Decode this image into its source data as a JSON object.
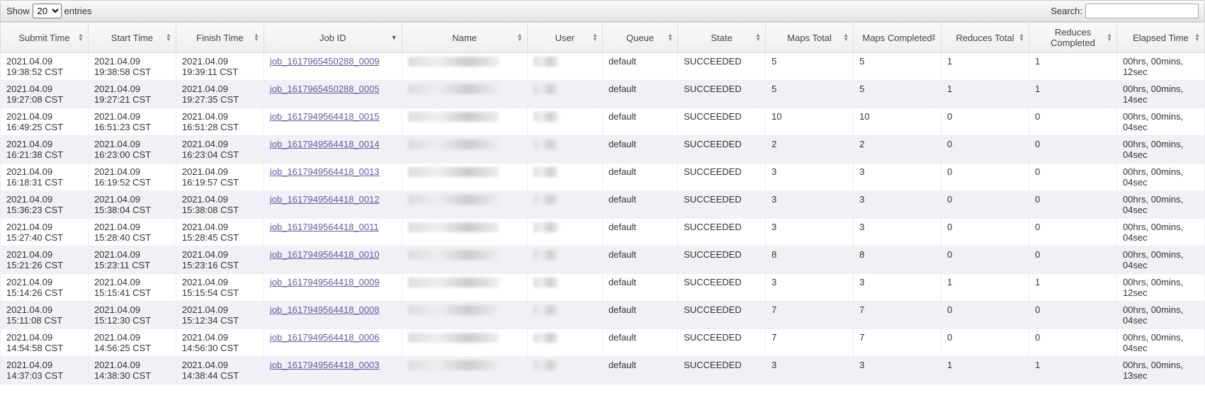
{
  "toolbar": {
    "show_label": "Show",
    "entries_label": "entries",
    "entries_value": "20",
    "search_label": "Search:"
  },
  "columns": [
    {
      "label": "Submit Time",
      "sort": "both"
    },
    {
      "label": "Start Time",
      "sort": "both"
    },
    {
      "label": "Finish Time",
      "sort": "both"
    },
    {
      "label": "Job ID",
      "sort": "desc"
    },
    {
      "label": "Name",
      "sort": "both"
    },
    {
      "label": "User",
      "sort": "both"
    },
    {
      "label": "Queue",
      "sort": "both"
    },
    {
      "label": "State",
      "sort": "both"
    },
    {
      "label": "Maps Total",
      "sort": "both"
    },
    {
      "label": "Maps Completed",
      "sort": "both"
    },
    {
      "label": "Reduces Total",
      "sort": "both"
    },
    {
      "label": "Reduces Completed",
      "sort": "both"
    },
    {
      "label": "Elapsed Time",
      "sort": "both"
    }
  ],
  "rows": [
    {
      "submit": "2021.04.09 19:38:52 CST",
      "start": "2021.04.09 19:38:58 CST",
      "finish": "2021.04.09 19:39:11 CST",
      "jobid": "job_1617965450288_0009",
      "queue": "default",
      "state": "SUCCEEDED",
      "maps": "5",
      "mapsc": "5",
      "red": "1",
      "redc": "1",
      "elapsed": "00hrs, 00mins, 12sec"
    },
    {
      "submit": "2021.04.09 19:27:08 CST",
      "start": "2021.04.09 19:27:21 CST",
      "finish": "2021.04.09 19:27:35 CST",
      "jobid": "job_1617965450288_0005",
      "queue": "default",
      "state": "SUCCEEDED",
      "maps": "5",
      "mapsc": "5",
      "red": "1",
      "redc": "1",
      "elapsed": "00hrs, 00mins, 14sec"
    },
    {
      "submit": "2021.04.09 16:49:25 CST",
      "start": "2021.04.09 16:51:23 CST",
      "finish": "2021.04.09 16:51:28 CST",
      "jobid": "job_1617949564418_0015",
      "queue": "default",
      "state": "SUCCEEDED",
      "maps": "10",
      "mapsc": "10",
      "red": "0",
      "redc": "0",
      "elapsed": "00hrs, 00mins, 04sec"
    },
    {
      "submit": "2021.04.09 16:21:38 CST",
      "start": "2021.04.09 16:23:00 CST",
      "finish": "2021.04.09 16:23:04 CST",
      "jobid": "job_1617949564418_0014",
      "queue": "default",
      "state": "SUCCEEDED",
      "maps": "2",
      "mapsc": "2",
      "red": "0",
      "redc": "0",
      "elapsed": "00hrs, 00mins, 04sec"
    },
    {
      "submit": "2021.04.09 16:18:31 CST",
      "start": "2021.04.09 16:19:52 CST",
      "finish": "2021.04.09 16:19:57 CST",
      "jobid": "job_1617949564418_0013",
      "queue": "default",
      "state": "SUCCEEDED",
      "maps": "3",
      "mapsc": "3",
      "red": "0",
      "redc": "0",
      "elapsed": "00hrs, 00mins, 04sec"
    },
    {
      "submit": "2021.04.09 15:36:23 CST",
      "start": "2021.04.09 15:38:04 CST",
      "finish": "2021.04.09 15:38:08 CST",
      "jobid": "job_1617949564418_0012",
      "queue": "default",
      "state": "SUCCEEDED",
      "maps": "3",
      "mapsc": "3",
      "red": "0",
      "redc": "0",
      "elapsed": "00hrs, 00mins, 04sec"
    },
    {
      "submit": "2021.04.09 15:27:40 CST",
      "start": "2021.04.09 15:28:40 CST",
      "finish": "2021.04.09 15:28:45 CST",
      "jobid": "job_1617949564418_0011",
      "queue": "default",
      "state": "SUCCEEDED",
      "maps": "3",
      "mapsc": "3",
      "red": "0",
      "redc": "0",
      "elapsed": "00hrs, 00mins, 04sec"
    },
    {
      "submit": "2021.04.09 15:21:26 CST",
      "start": "2021.04.09 15:23:11 CST",
      "finish": "2021.04.09 15:23:16 CST",
      "jobid": "job_1617949564418_0010",
      "queue": "default",
      "state": "SUCCEEDED",
      "maps": "8",
      "mapsc": "8",
      "red": "0",
      "redc": "0",
      "elapsed": "00hrs, 00mins, 04sec"
    },
    {
      "submit": "2021.04.09 15:14:26 CST",
      "start": "2021.04.09 15:15:41 CST",
      "finish": "2021.04.09 15:15:54 CST",
      "jobid": "job_1617949564418_0009",
      "queue": "default",
      "state": "SUCCEEDED",
      "maps": "3",
      "mapsc": "3",
      "red": "1",
      "redc": "1",
      "elapsed": "00hrs, 00mins, 12sec"
    },
    {
      "submit": "2021.04.09 15:11:08 CST",
      "start": "2021.04.09 15:12:30 CST",
      "finish": "2021.04.09 15:12:34 CST",
      "jobid": "job_1617949564418_0008",
      "queue": "default",
      "state": "SUCCEEDED",
      "maps": "7",
      "mapsc": "7",
      "red": "0",
      "redc": "0",
      "elapsed": "00hrs, 00mins, 04sec"
    },
    {
      "submit": "2021.04.09 14:54:58 CST",
      "start": "2021.04.09 14:56:25 CST",
      "finish": "2021.04.09 14:56:30 CST",
      "jobid": "job_1617949564418_0006",
      "queue": "default",
      "state": "SUCCEEDED",
      "maps": "7",
      "mapsc": "7",
      "red": "0",
      "redc": "0",
      "elapsed": "00hrs, 00mins, 04sec"
    },
    {
      "submit": "2021.04.09 14:37:03 CST",
      "start": "2021.04.09 14:38:30 CST",
      "finish": "2021.04.09 14:38:44 CST",
      "jobid": "job_1617949564418_0003",
      "queue": "default",
      "state": "SUCCEEDED",
      "maps": "3",
      "mapsc": "3",
      "red": "1",
      "redc": "1",
      "elapsed": "00hrs, 00mins, 13sec"
    }
  ]
}
